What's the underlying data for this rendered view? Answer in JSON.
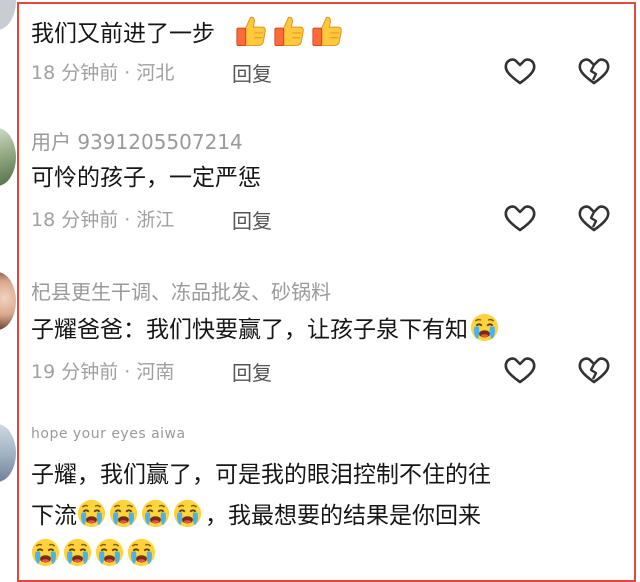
{
  "comments": [
    {
      "text": "我们又前进了一步",
      "time": "18 分钟前",
      "location": "河北",
      "reply": "回复",
      "emoji_icons": [
        "thumbs-up-icon",
        "thumbs-up-icon",
        "thumbs-up-icon"
      ]
    },
    {
      "username": "用户 9391205507214",
      "text": "可怜的孩子，一定严惩",
      "time": "18 分钟前",
      "location": "浙江",
      "reply": "回复"
    },
    {
      "username": "杞县更生干调、冻品批发、砂锅料",
      "text": "子耀爸爸：我们快要赢了，让孩子泉下有知",
      "time": "19 分钟前",
      "location": "河南",
      "reply": "回复",
      "emoji_icons": [
        "crying-face-icon"
      ]
    },
    {
      "username": "hope your eyes aiwa",
      "text_line1": "子耀，我们赢了，可是我的眼泪控制不住的往",
      "text_line2_a": "下流",
      "text_line2_b": "，我最想要的结果是你回来",
      "emoji_icons": [
        "crying-face-icon"
      ]
    }
  ],
  "meta_separator": " · ",
  "colors": {
    "frame": "#e8453c",
    "meta": "#a0a0a0",
    "username": "#9a9a9a"
  },
  "action_icons": [
    "heart-icon",
    "broken-heart-icon"
  ]
}
